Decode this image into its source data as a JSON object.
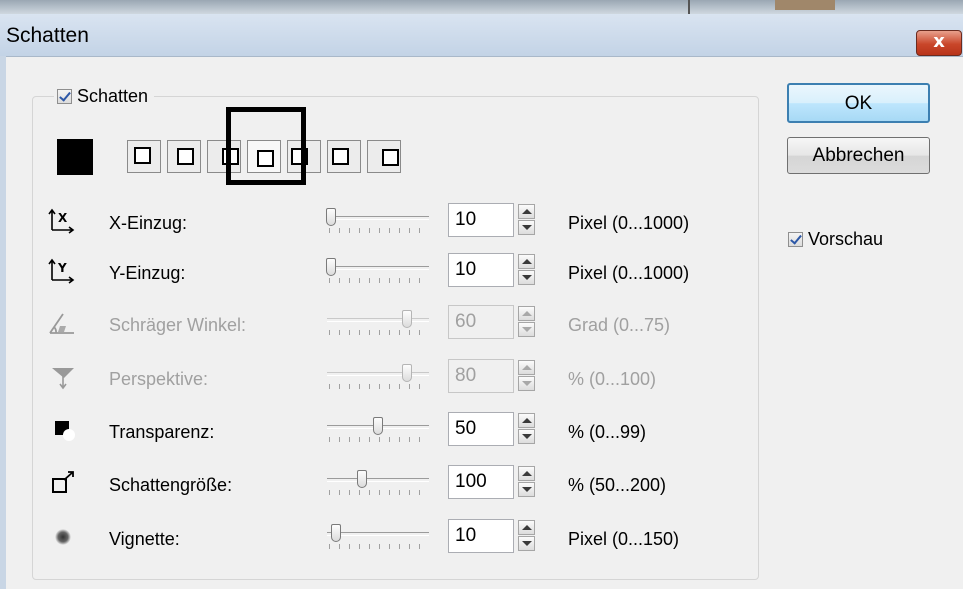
{
  "window": {
    "title": "Schatten",
    "close_glyph": "x"
  },
  "group": {
    "checkbox_label": "Schatten",
    "checked": true
  },
  "shadow_color": "#000000",
  "style_buttons": [
    {
      "name": "shadow-style-bottom-right"
    },
    {
      "name": "shadow-style-bottom-right-small"
    },
    {
      "name": "shadow-style-right"
    },
    {
      "name": "shadow-style-center"
    },
    {
      "name": "shadow-style-left"
    },
    {
      "name": "shadow-style-right-persp"
    },
    {
      "name": "shadow-style-left-persp"
    }
  ],
  "selected_style_index": 3,
  "params": [
    {
      "icon": "x-offset-icon",
      "label": "X-Einzug:",
      "value": "10",
      "unit": "Pixel (0...1000)",
      "enabled": true,
      "min": 0,
      "max": 1000
    },
    {
      "icon": "y-offset-icon",
      "label": "Y-Einzug:",
      "value": "10",
      "unit": "Pixel (0...1000)",
      "enabled": true,
      "min": 0,
      "max": 1000
    },
    {
      "icon": "angle-icon",
      "label": "Schräger Winkel:",
      "value": "60",
      "unit": "Grad (0...75)",
      "enabled": false,
      "min": 0,
      "max": 75
    },
    {
      "icon": "perspective-icon",
      "label": "Perspektive:",
      "value": "80",
      "unit": "% (0...100)",
      "enabled": false,
      "min": 0,
      "max": 100
    },
    {
      "icon": "transparency-icon",
      "label": "Transparenz:",
      "value": "50",
      "unit": "% (0...99)",
      "enabled": true,
      "min": 0,
      "max": 99
    },
    {
      "icon": "shadow-size-icon",
      "label": "Schattengröße:",
      "value": "100",
      "unit": "% (50...200)",
      "enabled": true,
      "min": 50,
      "max": 200
    },
    {
      "icon": "vignette-icon",
      "label": "Vignette:",
      "value": "10",
      "unit": "Pixel (0...150)",
      "enabled": true,
      "min": 0,
      "max": 150
    }
  ],
  "buttons": {
    "ok": "OK",
    "cancel": "Abbrechen"
  },
  "preview": {
    "label": "Vorschau",
    "checked": true
  }
}
